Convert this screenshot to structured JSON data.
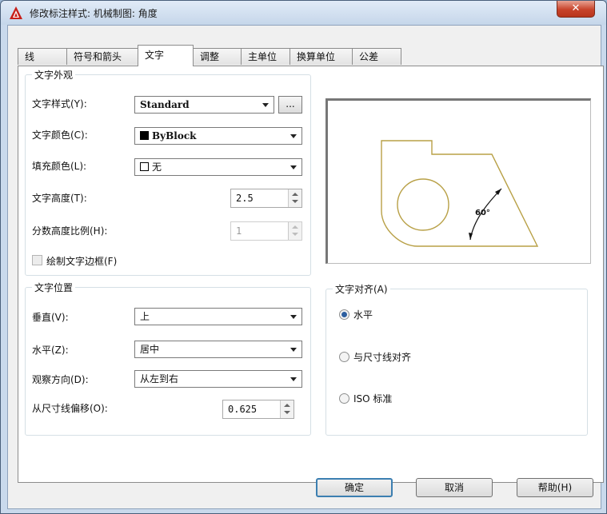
{
  "window": {
    "title": "修改标注样式: 机械制图: 角度",
    "close": "✕"
  },
  "tabs": [
    "线",
    "符号和箭头",
    "文字",
    "调整",
    "主单位",
    "换算单位",
    "公差"
  ],
  "appearance": {
    "title": "文字外观",
    "style_label": "文字样式(Y):",
    "style_value": "Standard",
    "style_browse": "...",
    "color_label": "文字颜色(C):",
    "color_value": "ByBlock",
    "fill_label": "填充颜色(L):",
    "fill_value": "无",
    "height_label": "文字高度(T):",
    "height_value": "2.5",
    "fraction_label": "分数高度比例(H):",
    "fraction_value": "1",
    "frame_label": "绘制文字边框(F)"
  },
  "placement": {
    "title": "文字位置",
    "vertical_label": "垂直(V):",
    "vertical_value": "上",
    "horizontal_label": "水平(Z):",
    "horizontal_value": "居中",
    "direction_label": "观察方向(D):",
    "direction_value": "从左到右",
    "offset_label": "从尺寸线偏移(O):",
    "offset_value": "0.625"
  },
  "alignment": {
    "title": "文字对齐(A)",
    "opt_horizontal": "水平",
    "opt_aligned": "与尺寸线对齐",
    "opt_iso": "ISO 标准",
    "selected": "horizontal"
  },
  "preview": {
    "angle_text": "60°",
    "line_color": "#b8a046"
  },
  "buttons": {
    "ok": "确定",
    "cancel": "取消",
    "help": "帮助(H)"
  }
}
